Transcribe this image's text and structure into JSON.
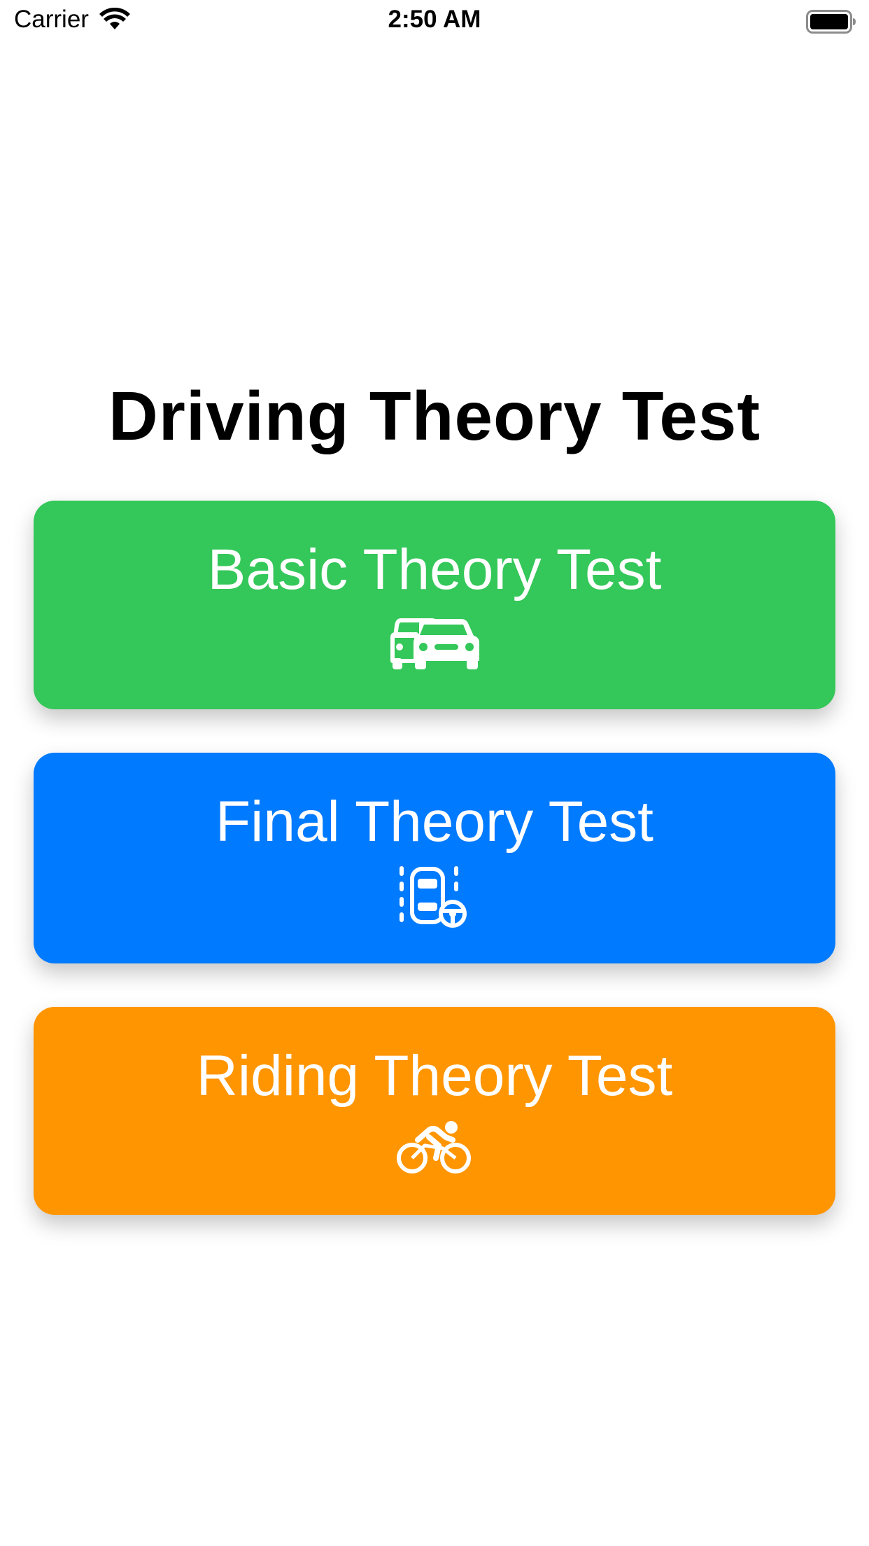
{
  "status_bar": {
    "carrier": "Carrier",
    "time": "2:50 AM"
  },
  "title": "Driving Theory Test",
  "buttons": [
    {
      "label": "Basic Theory Test",
      "icon": "cars-icon",
      "color": "#34C759"
    },
    {
      "label": "Final Theory Test",
      "icon": "car-lane-steering-icon",
      "color": "#007AFF"
    },
    {
      "label": "Riding Theory Test",
      "icon": "bicycle-rider-icon",
      "color": "#FF9500"
    }
  ]
}
